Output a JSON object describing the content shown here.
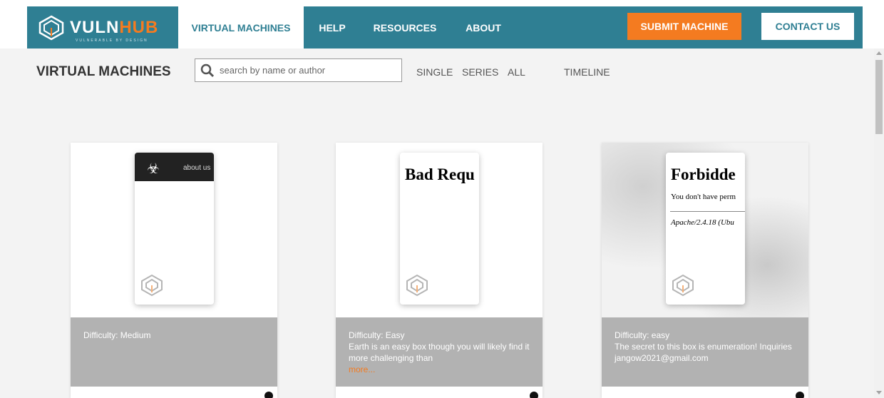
{
  "brand": {
    "logo_text_a": "VULN",
    "logo_text_b": "HUB",
    "tagline": "VULNERABLE BY DESIGN"
  },
  "nav": {
    "items": [
      {
        "label": "VIRTUAL MACHINES"
      },
      {
        "label": "HELP"
      },
      {
        "label": "RESOURCES"
      },
      {
        "label": "ABOUT"
      }
    ],
    "submit_label": "SUBMIT MACHINE",
    "contact_label": "CONTACT US"
  },
  "page": {
    "title": "VIRTUAL MACHINES"
  },
  "search": {
    "placeholder": "search by name or author",
    "value": ""
  },
  "filters": [
    "SINGLE",
    "SERIES",
    "ALL",
    "TIMELINE"
  ],
  "cards": [
    {
      "preview": {
        "bar_text": "about us"
      },
      "difficulty": "Difficulty: Medium",
      "description": ""
    },
    {
      "preview": {
        "title": "Bad Requ"
      },
      "difficulty": "Difficulty: Easy",
      "description": "Earth is an easy box though you will likely find it more challenging than",
      "more": "more..."
    },
    {
      "preview": {
        "title": "Forbidde",
        "line1": "You don't have perm",
        "line2": "Apache/2.4.18 (Ubu"
      },
      "difficulty": "Difficulty: easy",
      "description": "The secret to this box is enumeration! Inquiries jangow2021@gmail.com"
    }
  ],
  "colors": {
    "nav_bg": "#2f7f93",
    "accent": "#f47b20",
    "info_bg": "#b2b2b2"
  }
}
